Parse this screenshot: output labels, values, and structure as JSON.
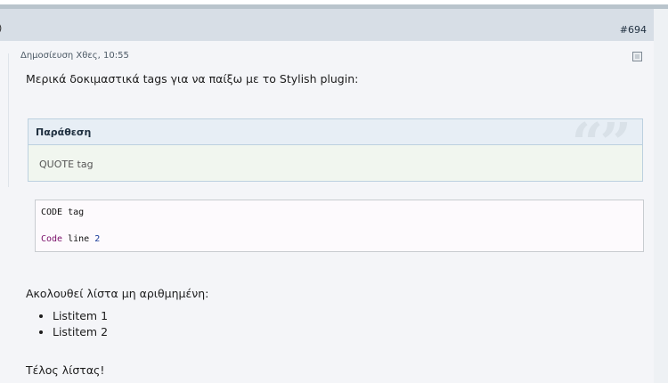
{
  "post": {
    "number": "#694",
    "left_marker": ")",
    "meta": "Δημοσίευση Χθες, 10:55",
    "intro": "Μερικά δοκιμαστικά tags για να παίξω με το Stylish plugin:",
    "quote": {
      "title": "Παράθεση",
      "content": "QUOTE tag",
      "mark": "“”"
    },
    "code": {
      "line1": "CODE tag",
      "line2_keyword": "Code",
      "line2_word": "line",
      "line2_number": "2"
    },
    "list_intro": "Ακολουθεί λίστα μη αριθμημένη:",
    "list_items": [
      "Listitem 1",
      "Listitem 2"
    ],
    "end_text": "Τέλος λίστας!"
  },
  "colors": {
    "header_bar": "#d7dee6",
    "quote_border": "#bcd0df",
    "code_keyword": "#7a0f6a",
    "code_number": "#1a3c9a"
  }
}
